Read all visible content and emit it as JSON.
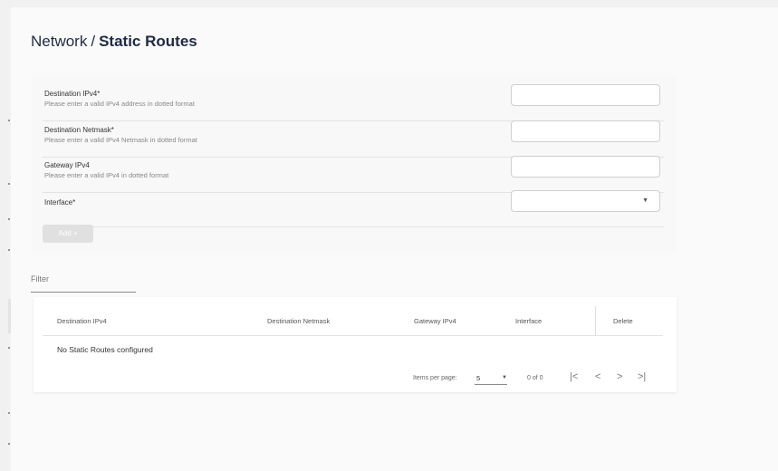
{
  "header": {
    "breadcrumb_parent": "Network",
    "separator": "/",
    "title": "Static Routes"
  },
  "form": {
    "fields": [
      {
        "label": "Destination IPv4*",
        "hint": "Please enter a valid IPv4 address in dotted format",
        "value": ""
      },
      {
        "label": "Destination Netmask*",
        "hint": "Please enter a valid IPv4 Netmask in dotted format",
        "value": ""
      },
      {
        "label": "Gateway IPv4",
        "hint": "Please enter a valid IPv4 in dotted format",
        "value": ""
      },
      {
        "label": "Interface*",
        "hint": "",
        "value": ""
      }
    ],
    "add_button": "Add +"
  },
  "filter": {
    "placeholder": "Filter",
    "value": ""
  },
  "table": {
    "columns": [
      "Destination IPv4",
      "Destination Netmask",
      "Gateway IPv4",
      "Interface",
      "Delete"
    ],
    "empty_message": "No Static Routes configured"
  },
  "paginator": {
    "items_per_page_label": "Items per page:",
    "page_size": "5",
    "range_label": "0 of 0",
    "first_icon": "first-page-icon",
    "prev_icon": "previous-page-icon",
    "next_icon": "next-page-icon",
    "last_icon": "last-page-icon"
  },
  "colors": {
    "title": "#1f2a44",
    "background": "#fafafa",
    "disabled_button": "#e0e0e0"
  }
}
